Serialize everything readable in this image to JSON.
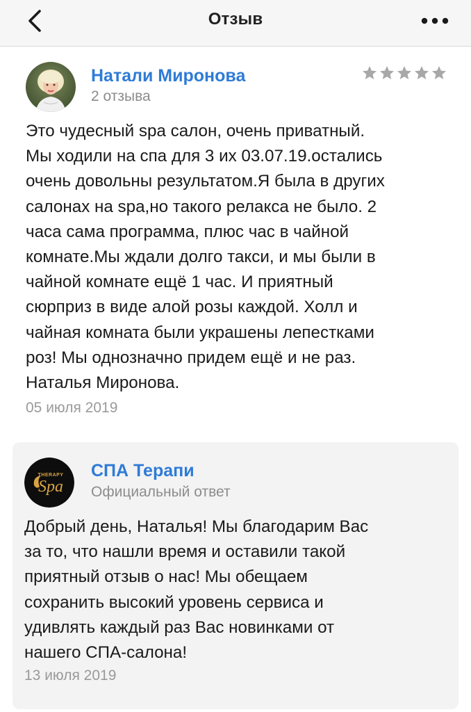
{
  "header": {
    "title": "Отзыв",
    "back_icon": "chevron-left-icon",
    "more_icon": "more-horizontal-icon"
  },
  "review": {
    "author": "Натали Миронова",
    "author_sub": "2 отзыва",
    "rating": 5,
    "rating_max": 5,
    "star_color": "#a8a8a8",
    "text": "Это чудесный spa салон, очень приватный.\nМы ходили на спа для 3 их 03.07.19.остались\nочень довольны результатом.Я была в других\nсалонах на spa,но такого релакса не было. 2\nчаса сама программа, плюс час в чайной\nкомнате.Мы ждали долго такси, и мы были в\nчайной комнате ещё 1 час. И приятный\nсюрприз в виде алой розы каждой. Холл и\nчайная комната были украшены лепестками\nроз! Мы однозначно придем ещё и не раз.\nНаталья Миронова.",
    "date": "05 июля 2019"
  },
  "reply": {
    "author": "СПА Терапи",
    "author_sub": "Официальный ответ",
    "text": "Добрый день, Наталья! Мы благодарим Вас\nза то, что нашли время и оставили такой\nприятный отзыв о нас! Мы обещаем\nсохранить высокий уровень сервиса и\nудивлять каждый раз Вас новинками от\nнашего СПА-салона!",
    "date": "13 июля 2019",
    "logo_text_top": "THERAPY",
    "logo_text_main": "Spa"
  },
  "colors": {
    "link": "#2f7bd6",
    "muted": "#8c8c8c",
    "reply_bg": "#f3f3f3"
  }
}
